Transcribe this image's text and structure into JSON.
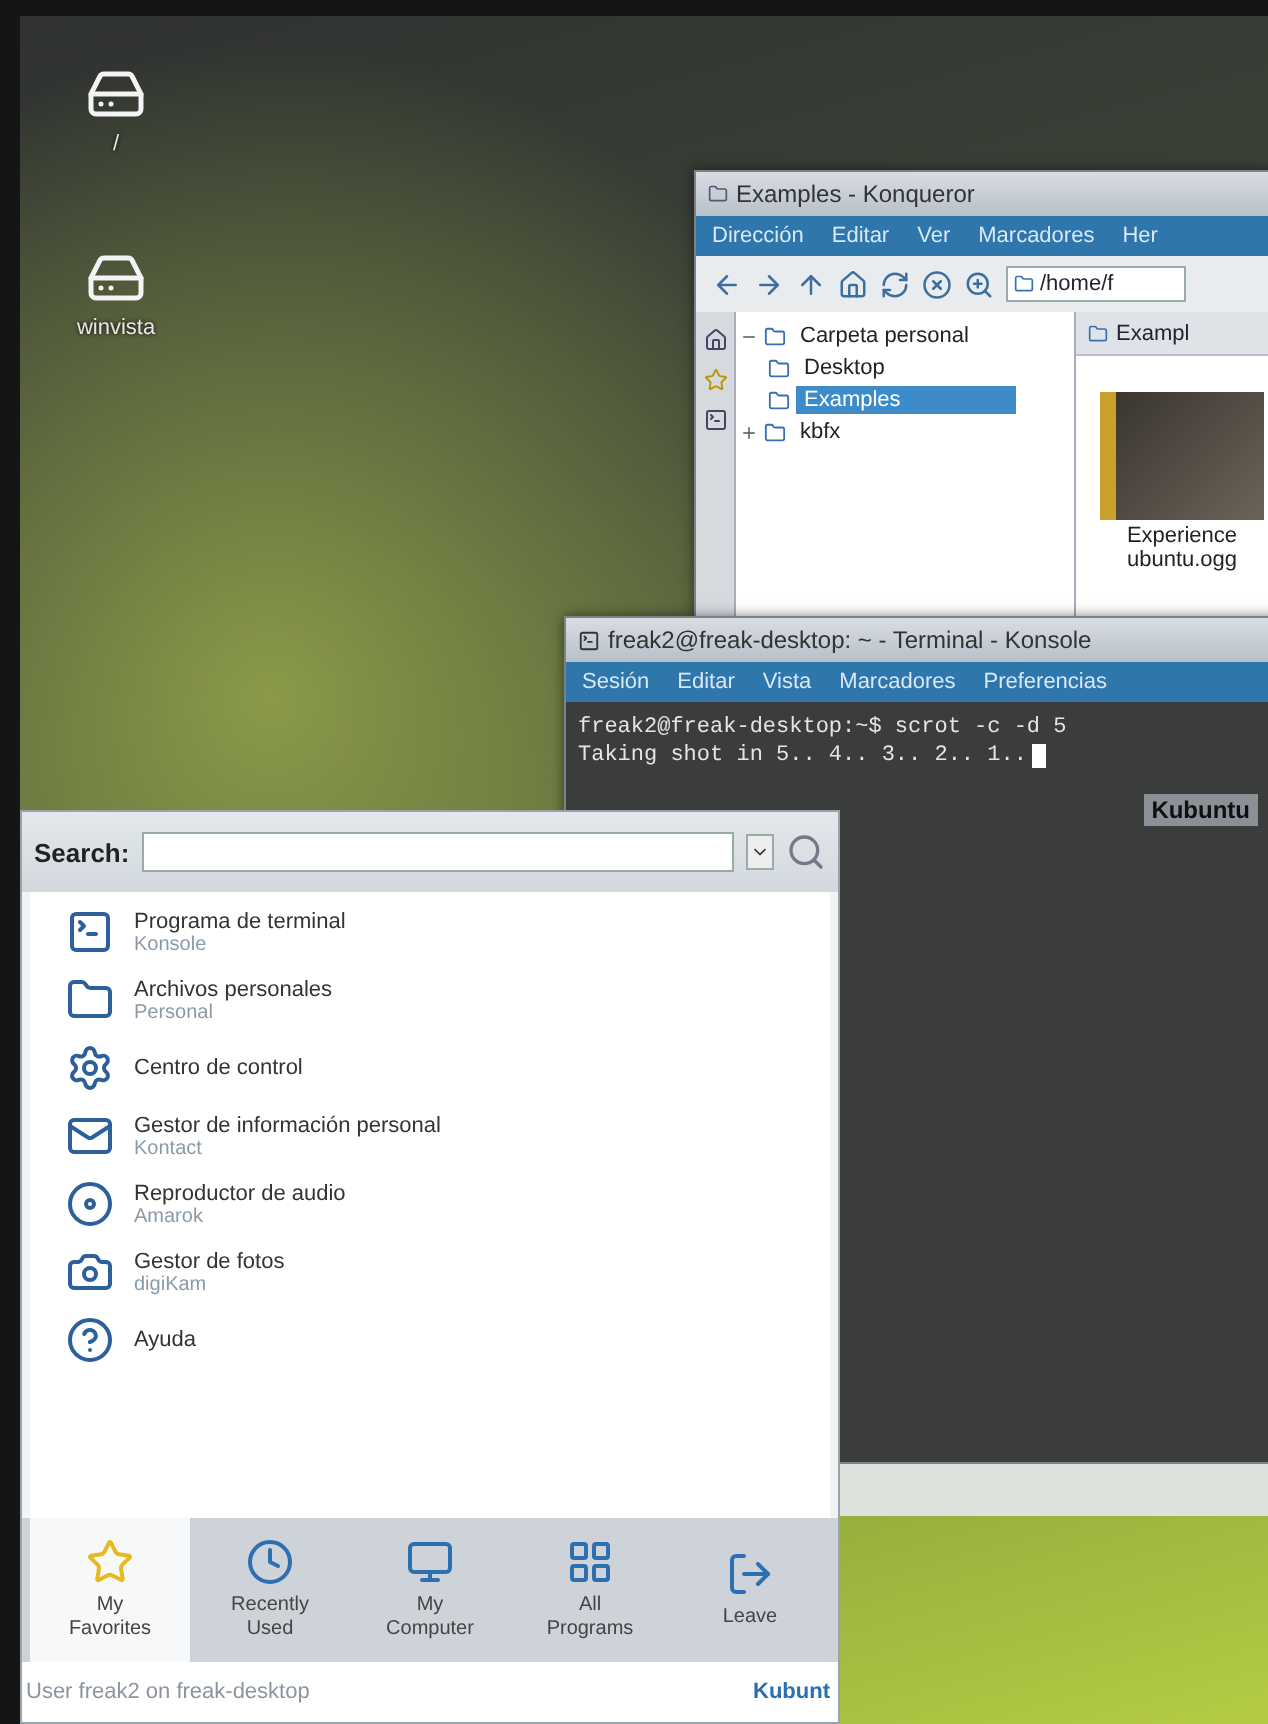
{
  "desktop_icons": [
    {
      "label": "/"
    },
    {
      "label": "winvista"
    }
  ],
  "konqueror": {
    "title": "Examples - Konqueror",
    "menu": [
      "Dirección",
      "Editar",
      "Ver",
      "Marcadores",
      "Her"
    ],
    "location": "/home/f",
    "tree": [
      {
        "label": "Carpeta personal",
        "expanded": true,
        "selected": false,
        "children": [
          {
            "label": "Desktop",
            "selected": false
          },
          {
            "label": "Examples",
            "selected": true
          }
        ]
      },
      {
        "label": "kbfx",
        "expanded": false,
        "selected": false
      }
    ],
    "view_tab": "Exampl",
    "file": {
      "name": "Experience ubuntu.ogg"
    }
  },
  "terminal": {
    "title": "freak2@freak-desktop: ~ - Terminal - Konsole",
    "menu": [
      "Sesión",
      "Editar",
      "Vista",
      "Marcadores",
      "Preferencias"
    ],
    "lines": [
      "freak2@freak-desktop:~$ scrot -c -d 5",
      "Taking shot in 5.. 4.. 3.. 2.. 1.."
    ],
    "logo": "Kubuntu"
  },
  "kickoff": {
    "search_label": "Search:",
    "items": [
      {
        "title": "Programa de terminal",
        "subtitle": "Konsole"
      },
      {
        "title": "Archivos personales",
        "subtitle": "Personal"
      },
      {
        "title": "Centro de control"
      },
      {
        "title": "Gestor de información personal",
        "subtitle": "Kontact"
      },
      {
        "title": "Reproductor de audio",
        "subtitle": "Amarok"
      },
      {
        "title": "Gestor de fotos",
        "subtitle": "digiKam"
      },
      {
        "title": "Ayuda"
      }
    ],
    "tabs": [
      {
        "label": "My Favorites",
        "selected": true
      },
      {
        "label": "Recently Used",
        "selected": false
      },
      {
        "label": "My Computer",
        "selected": false
      },
      {
        "label": "All Programs",
        "selected": false
      },
      {
        "label": "Leave",
        "selected": false
      }
    ],
    "footer": "User freak2 on freak-desktop",
    "logo": "Kubunt"
  }
}
